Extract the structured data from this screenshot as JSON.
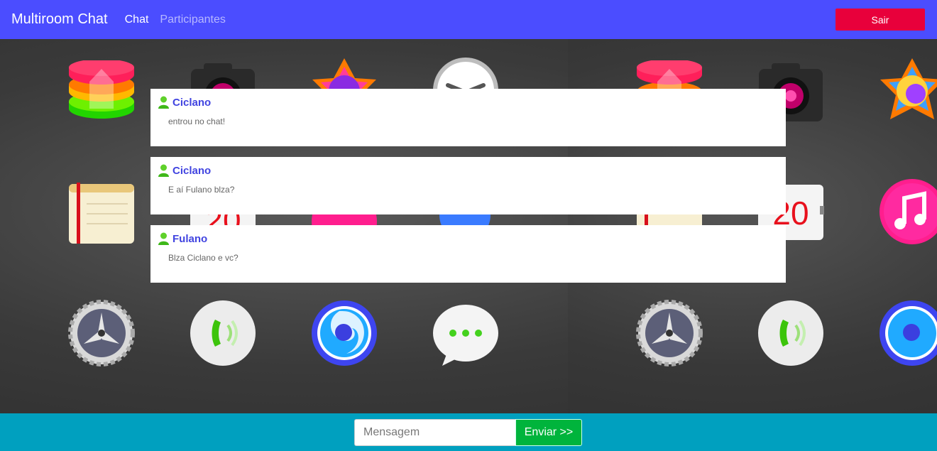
{
  "navbar": {
    "brand": "Multiroom Chat",
    "links": [
      {
        "label": "Chat",
        "active": true
      },
      {
        "label": "Participantes",
        "active": false
      }
    ],
    "logout_label": "Sair",
    "accent": "#4b4dff",
    "logout_color": "#e8003b"
  },
  "wallpaper": {
    "icons": [
      "stack-app-icon",
      "camera-icon",
      "photos-icon",
      "clock-icon",
      "notes-icon",
      "calendar-icon",
      "music-icon",
      "settings-gear-icon",
      "phone-icon",
      "browser-icon",
      "messages-icon"
    ],
    "calendar_day": "20"
  },
  "messages": [
    {
      "user": "Ciclano",
      "text": "entrou no chat!"
    },
    {
      "user": "Ciclano",
      "text": "E aí Fulano blza?"
    },
    {
      "user": "Fulano",
      "text": "Blza Ciclano e vc?"
    }
  ],
  "footer": {
    "input_placeholder": "Mensagem",
    "send_label": "Enviar >>",
    "bg_color": "#00a0bf",
    "send_color": "#00b43c"
  }
}
